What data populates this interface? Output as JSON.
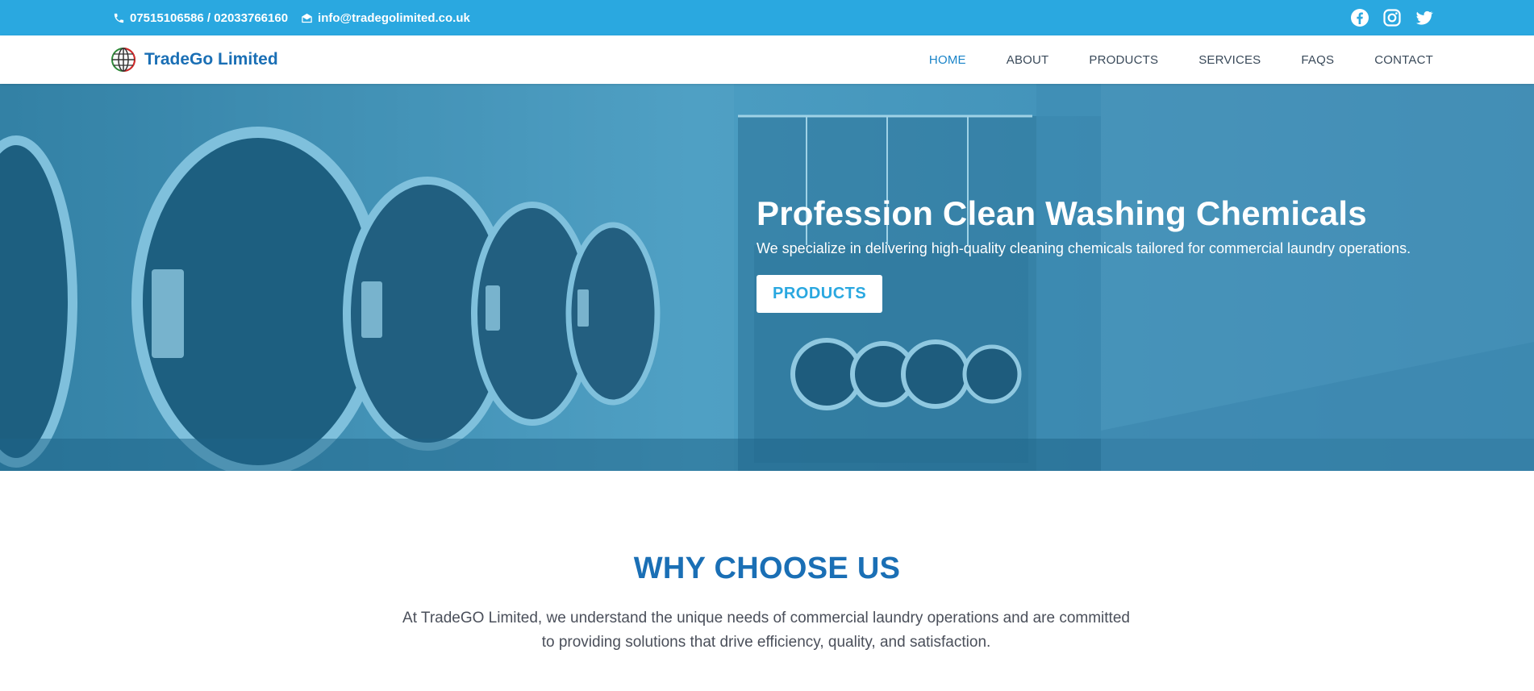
{
  "topbar": {
    "phone": "07515106586 / 02033766160",
    "email": "info@tradegolimited.co.uk",
    "phone_icon": "phone-icon",
    "email_icon": "envelope-icon",
    "social": [
      "facebook-icon",
      "instagram-icon",
      "twitter-icon"
    ],
    "bg_color": "#2aa8e0"
  },
  "nav": {
    "brand": "TradeGo Limited",
    "items": [
      "HOME",
      "ABOUT",
      "PRODUCTS",
      "SERVICES",
      "FAQS",
      "CONTACT"
    ],
    "active": "HOME",
    "accent_color": "#1a6fb5"
  },
  "hero": {
    "title": "Profession Clean Washing Chemicals",
    "subtitle": "We specialize in delivering high-quality cleaning chemicals tailored for commercial laundry operations.",
    "button": "PRODUCTS",
    "overlay_color": "#2e7ea5"
  },
  "why": {
    "title": "WHY CHOOSE US",
    "text": "At TradeGO Limited, we understand the unique needs of commercial laundry operations and are committed to providing solutions that drive efficiency, quality, and satisfaction."
  }
}
